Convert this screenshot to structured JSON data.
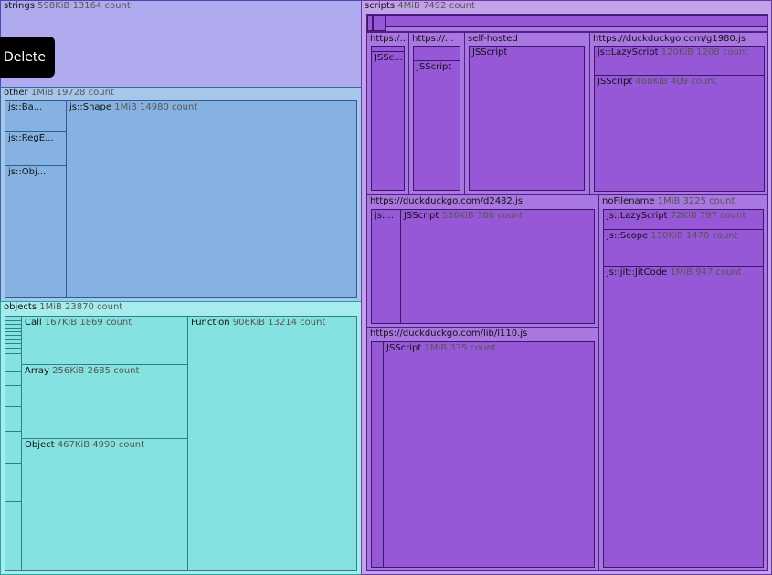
{
  "strings": {
    "name": "strings",
    "meta": "598KiB 13164 count"
  },
  "delete_label": "Delete",
  "other": {
    "name": "other",
    "meta": "1MiB 19728 count",
    "items": [
      {
        "label": "js::Ba..."
      },
      {
        "label": "js::RegE..."
      },
      {
        "label": "js::Obj..."
      },
      {
        "label": "js::Shape",
        "meta": "1MiB 14980 count"
      }
    ]
  },
  "objects": {
    "name": "objects",
    "meta": "1MiB 23870 count",
    "call": {
      "label": "Call",
      "meta": "167KiB 1869 count"
    },
    "array": {
      "label": "Array",
      "meta": "256KiB 2685 count"
    },
    "object": {
      "label": "Object",
      "meta": "467KiB 4990 count"
    },
    "function": {
      "label": "Function",
      "meta": "906KiB 13214 count"
    }
  },
  "scripts": {
    "name": "scripts",
    "meta": "4MiB 7492 count",
    "small1": {
      "label": "https:/...",
      "child": "JSSc..."
    },
    "small2": {
      "label": "https://...",
      "child": "JSScript"
    },
    "selfhosted": {
      "label": "self-hosted",
      "child": "JSScript"
    },
    "g1980": {
      "label": "https://duckduckgo.com/g1980.js",
      "lazy": {
        "label": "js::LazyScript",
        "meta": "120KiB 1208 count"
      },
      "jsscript": {
        "label": "JSScript",
        "meta": "468KiB 409 count"
      }
    },
    "d2482": {
      "label": "https://duckduckgo.com/d2482.js",
      "small": "js:...",
      "jsscript": {
        "label": "JSScript",
        "meta": "536KiB 386 count"
      }
    },
    "nofilename": {
      "label": "noFilename",
      "meta": "1MiB 3225 count",
      "lazy": {
        "label": "js::LazyScript",
        "meta": "72KiB 797 count"
      },
      "scope": {
        "label": "js::Scope",
        "meta": "130KiB 1478 count"
      },
      "jit": {
        "label": "js::jit::JitCode",
        "meta": "1MiB 947 count"
      }
    },
    "l110": {
      "label": "https://duckduckgo.com/lib/l110.js",
      "jsscript": {
        "label": "JSScript",
        "meta": "1MiB 335 count"
      }
    }
  }
}
